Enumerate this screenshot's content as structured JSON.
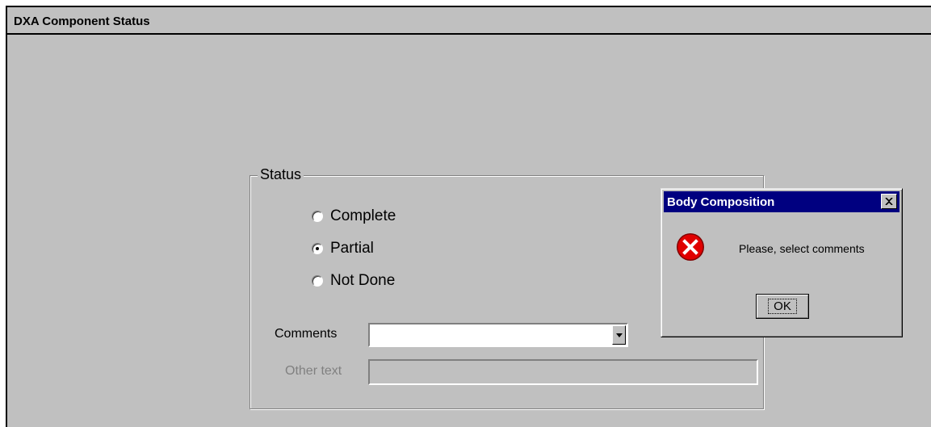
{
  "window": {
    "title": "DXA Component Status"
  },
  "status_group": {
    "legend": "Status",
    "options": [
      {
        "label": "Complete",
        "checked": false
      },
      {
        "label": "Partial",
        "checked": true
      },
      {
        "label": "Not Done",
        "checked": false
      }
    ]
  },
  "comments": {
    "label": "Comments",
    "value": ""
  },
  "other_text": {
    "label": "Other text",
    "value": ""
  },
  "dialog": {
    "title": "Body Composition",
    "message": "Please, select comments",
    "ok_label": "OK",
    "icon": "error-icon",
    "title_color": "#000080"
  },
  "colors": {
    "face": "#c0c0c0",
    "error_red": "#e00000"
  }
}
